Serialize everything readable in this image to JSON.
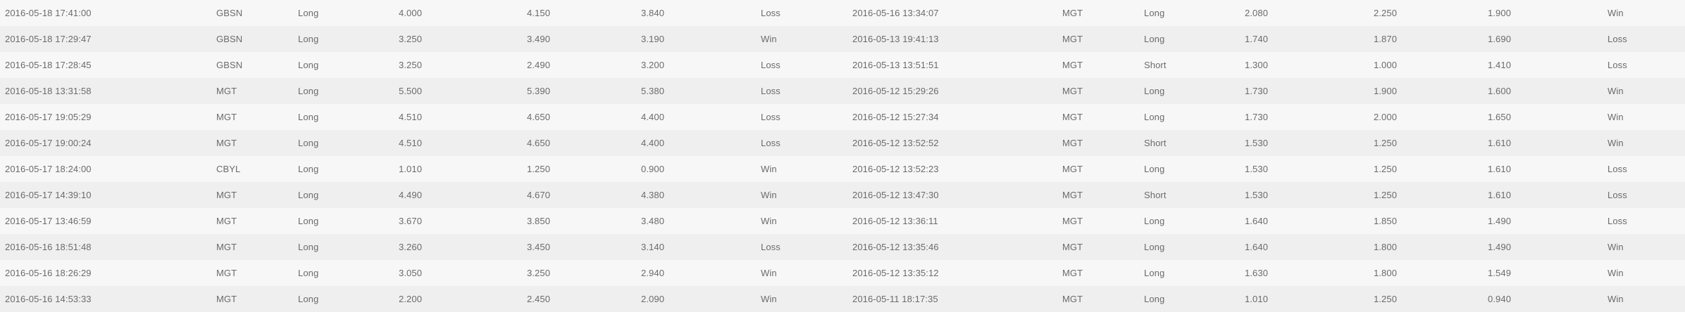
{
  "trades_table": {
    "rows": [
      [
        "2016-05-18 17:41:00",
        "GBSN",
        "Long",
        "4.000",
        "4.150",
        "3.840",
        "Loss",
        "2016-05-16 13:34:07",
        "MGT",
        "Long",
        "2.080",
        "2.250",
        "1.900",
        "Win"
      ],
      [
        "2016-05-18 17:29:47",
        "GBSN",
        "Long",
        "3.250",
        "3.490",
        "3.190",
        "Win",
        "2016-05-13 19:41:13",
        "MGT",
        "Long",
        "1.740",
        "1.870",
        "1.690",
        "Loss"
      ],
      [
        "2016-05-18 17:28:45",
        "GBSN",
        "Long",
        "3.250",
        "2.490",
        "3.200",
        "Loss",
        "2016-05-13 13:51:51",
        "MGT",
        "Short",
        "1.300",
        "1.000",
        "1.410",
        "Loss"
      ],
      [
        "2016-05-18 13:31:58",
        "MGT",
        "Long",
        "5.500",
        "5.390",
        "5.380",
        "Loss",
        "2016-05-12 15:29:26",
        "MGT",
        "Long",
        "1.730",
        "1.900",
        "1.600",
        "Win"
      ],
      [
        "2016-05-17 19:05:29",
        "MGT",
        "Long",
        "4.510",
        "4.650",
        "4.400",
        "Loss",
        "2016-05-12 15:27:34",
        "MGT",
        "Long",
        "1.730",
        "2.000",
        "1.650",
        "Win"
      ],
      [
        "2016-05-17 19:00:24",
        "MGT",
        "Long",
        "4.510",
        "4.650",
        "4.400",
        "Loss",
        "2016-05-12 13:52:52",
        "MGT",
        "Short",
        "1.530",
        "1.250",
        "1.610",
        "Win"
      ],
      [
        "2016-05-17 18:24:00",
        "CBYL",
        "Long",
        "1.010",
        "1.250",
        "0.900",
        "Win",
        "2016-05-12 13:52:23",
        "MGT",
        "Long",
        "1.530",
        "1.250",
        "1.610",
        "Loss"
      ],
      [
        "2016-05-17 14:39:10",
        "MGT",
        "Long",
        "4.490",
        "4.670",
        "4.380",
        "Win",
        "2016-05-12 13:47:30",
        "MGT",
        "Short",
        "1.530",
        "1.250",
        "1.610",
        "Loss"
      ],
      [
        "2016-05-17 13:46:59",
        "MGT",
        "Long",
        "3.670",
        "3.850",
        "3.480",
        "Win",
        "2016-05-12 13:36:11",
        "MGT",
        "Long",
        "1.640",
        "1.850",
        "1.490",
        "Loss"
      ],
      [
        "2016-05-16 18:51:48",
        "MGT",
        "Long",
        "3.260",
        "3.450",
        "3.140",
        "Loss",
        "2016-05-12 13:35:46",
        "MGT",
        "Long",
        "1.640",
        "1.800",
        "1.490",
        "Win"
      ],
      [
        "2016-05-16 18:26:29",
        "MGT",
        "Long",
        "3.050",
        "3.250",
        "2.940",
        "Win",
        "2016-05-12 13:35:12",
        "MGT",
        "Long",
        "1.630",
        "1.800",
        "1.549",
        "Win"
      ],
      [
        "2016-05-16 14:53:33",
        "MGT",
        "Long",
        "2.200",
        "2.450",
        "2.090",
        "Win",
        "2016-05-11 18:17:35",
        "MGT",
        "Long",
        "1.010",
        "1.250",
        "0.940",
        "Win"
      ]
    ]
  }
}
